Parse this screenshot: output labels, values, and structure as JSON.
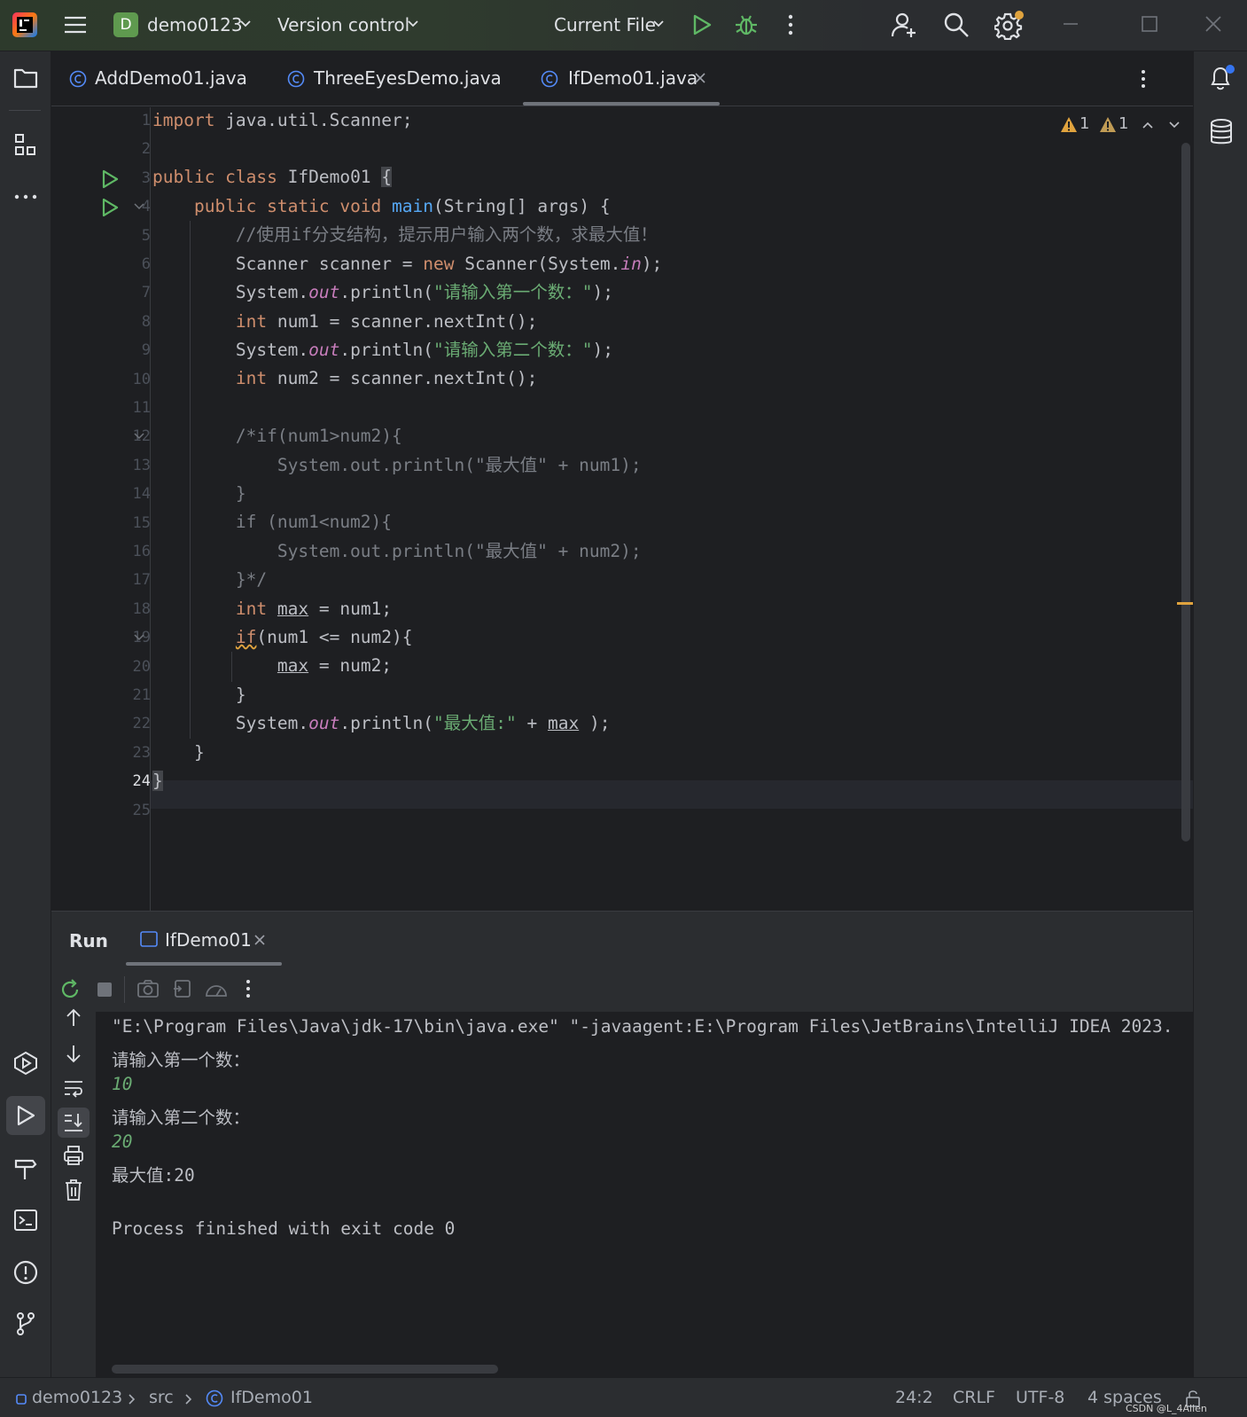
{
  "titlebar": {
    "project_badge": "D",
    "project_name": "demo0123",
    "vcs_label": "Version control",
    "run_config": "Current File"
  },
  "tabs": [
    {
      "label": "AddDemo01.java"
    },
    {
      "label": "ThreeEyesDemo.java"
    },
    {
      "label": "IfDemo01.java",
      "active": true
    }
  ],
  "inspections": {
    "errors": "1",
    "warnings": "1"
  },
  "editor": {
    "line_numbers": [
      "1",
      "2",
      "3",
      "4",
      "5",
      "6",
      "7",
      "8",
      "9",
      "10",
      "11",
      "12",
      "13",
      "14",
      "15",
      "16",
      "17",
      "18",
      "19",
      "20",
      "21",
      "22",
      "23",
      "24",
      "25"
    ],
    "current_line": "24",
    "code": {
      "l1_kw": "import",
      "l1_rest": " java.util.Scanner;",
      "l3_kw": "public class",
      "l3_name": " IfDemo01 ",
      "l3_brace": "{",
      "l4_kw": "public static void",
      "l4_fn": "main",
      "l4_rest": "(String[] args) {",
      "l5": "//使用if分支结构，提示用户输入两个数，求最大值！",
      "l6_a": "Scanner scanner = ",
      "l6_kw": "new",
      "l6_b": " Scanner(System.",
      "l6_fld": "in",
      "l6_c": ");",
      "l7_a": "System.",
      "l7_fld": "out",
      "l7_b": ".println(",
      "l7_str": "\"请输入第一个数：\"",
      "l7_c": ");",
      "l8_kw": "int",
      "l8_rest": " num1 = scanner.nextInt();",
      "l9_a": "System.",
      "l9_fld": "out",
      "l9_b": ".println(",
      "l9_str": "\"请输入第二个数：\"",
      "l9_c": ");",
      "l10_kw": "int",
      "l10_rest": " num2 = scanner.nextInt();",
      "l12": "/*if(num1>num2){",
      "l13": "    System.out.println(\"最大值\" + num1);",
      "l14": "}",
      "l15": "if (num1<num2){",
      "l16": "    System.out.println(\"最大值\" + num2);",
      "l17": "}*/",
      "l18_kw": "int",
      "l18_var": "max",
      "l18_rest": " = num1;",
      "l19_kw": "if",
      "l19_rest": "(num1 <= num2){",
      "l20_var": "max",
      "l20_rest": " = num2;",
      "l21": "}",
      "l22_a": "System.",
      "l22_fld": "out",
      "l22_b": ".println(",
      "l22_str": "\"最大值:\"",
      "l22_c": " + ",
      "l22_var": "max",
      "l22_d": " );",
      "l23": "}",
      "l24": "}"
    }
  },
  "run_panel": {
    "title": "Run",
    "tab_label": "IfDemo01",
    "console": {
      "cmd": "\"E:\\Program Files\\Java\\jdk-17\\bin\\java.exe\" \"-javaagent:E:\\Program Files\\JetBrains\\IntelliJ IDEA 2023.",
      "prompt1": "请输入第一个数：",
      "input1": "10",
      "prompt2": "请输入第二个数：",
      "input2": "20",
      "result": "最大值:20",
      "exit": "Process finished with exit code 0"
    }
  },
  "statusbar": {
    "crumb_project": "demo0123",
    "crumb_src": "src",
    "crumb_class": "IfDemo01",
    "position": "24:2",
    "line_sep": "CRLF",
    "encoding": "UTF-8",
    "indent": "4 spaces",
    "watermark": "CSDN @L_4Allen"
  },
  "colors": {
    "keyword": "#cf8e6d",
    "function": "#56a8f5",
    "string": "#6aab73",
    "field": "#c77dbb",
    "comment": "#7a7e85",
    "warning": "#e0a33e",
    "run_green": "#5fb865"
  }
}
